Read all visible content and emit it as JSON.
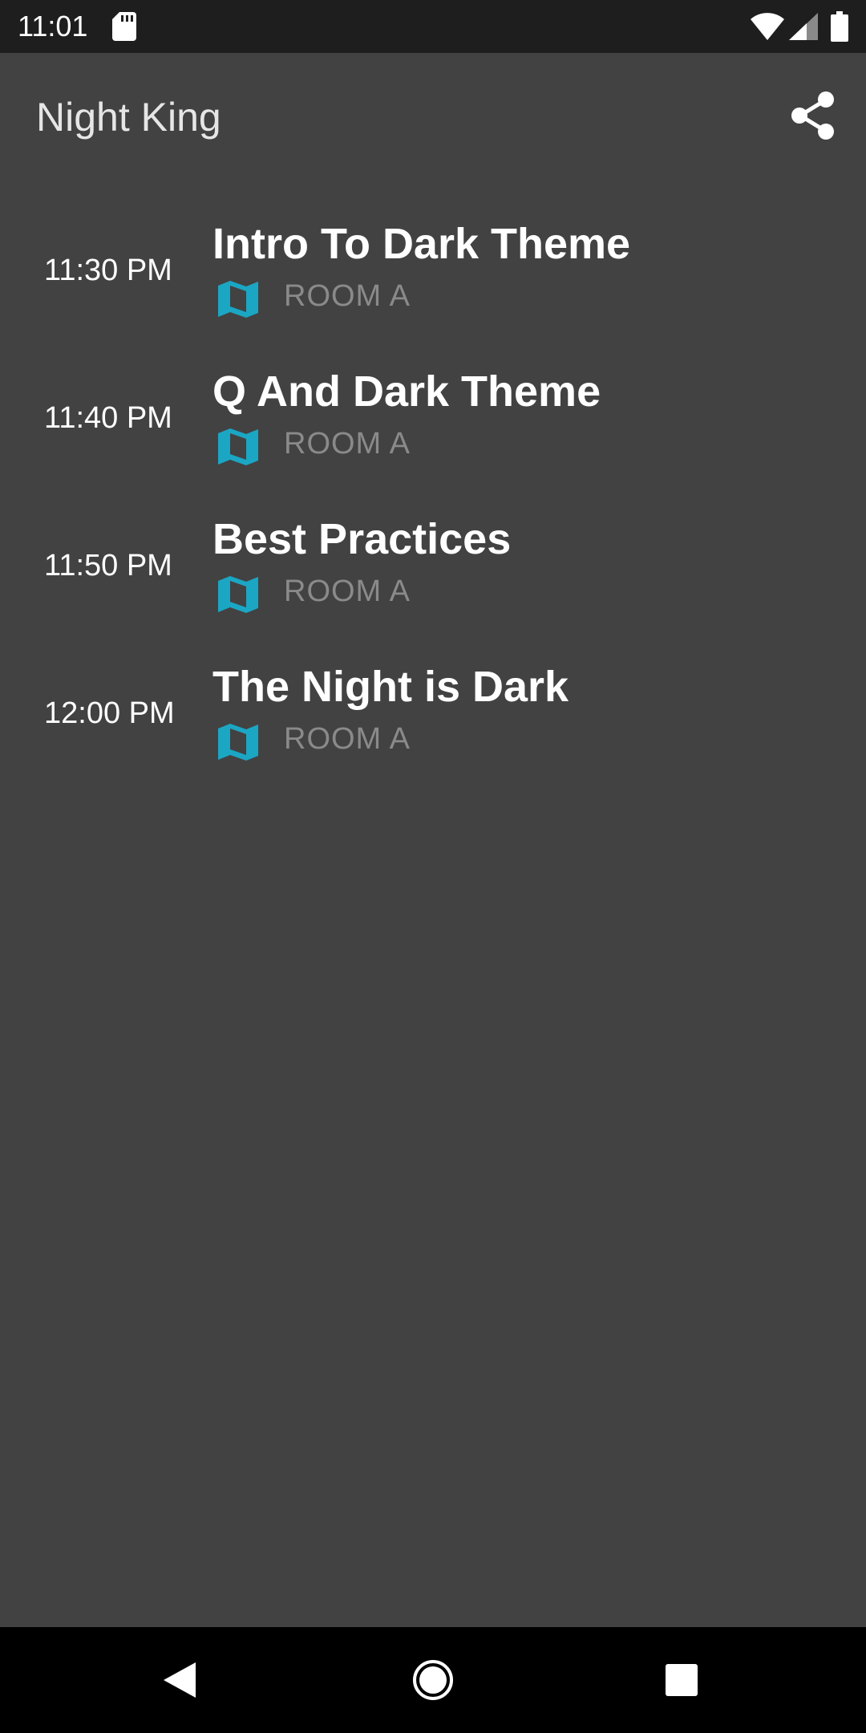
{
  "status_bar": {
    "time": "11:01",
    "icons": [
      "sd-card-icon",
      "wifi-icon",
      "cell-signal-icon",
      "battery-icon"
    ]
  },
  "app_bar": {
    "title": "Night King",
    "action_icon": "share-icon"
  },
  "sessions": [
    {
      "time": "11:30 PM",
      "title": "Intro To Dark Theme",
      "room": "ROOM A",
      "icon": "map-icon"
    },
    {
      "time": "11:40 PM",
      "title": "Q And Dark Theme",
      "room": "ROOM A",
      "icon": "map-icon"
    },
    {
      "time": "11:50 PM",
      "title": "Best Practices",
      "room": "ROOM A",
      "icon": "map-icon"
    },
    {
      "time": "12:00 PM",
      "title": "The Night is Dark",
      "room": "ROOM A",
      "icon": "map-icon"
    }
  ],
  "nav_bar": {
    "icons": [
      "back-icon",
      "home-icon",
      "recents-icon"
    ]
  },
  "colors": {
    "background": "#424242",
    "status_bar": "#1e1e1e",
    "nav_bar": "#000000",
    "accent": "#1ba6c4",
    "room_text": "#8a8a8a",
    "text_primary": "#ffffff"
  }
}
